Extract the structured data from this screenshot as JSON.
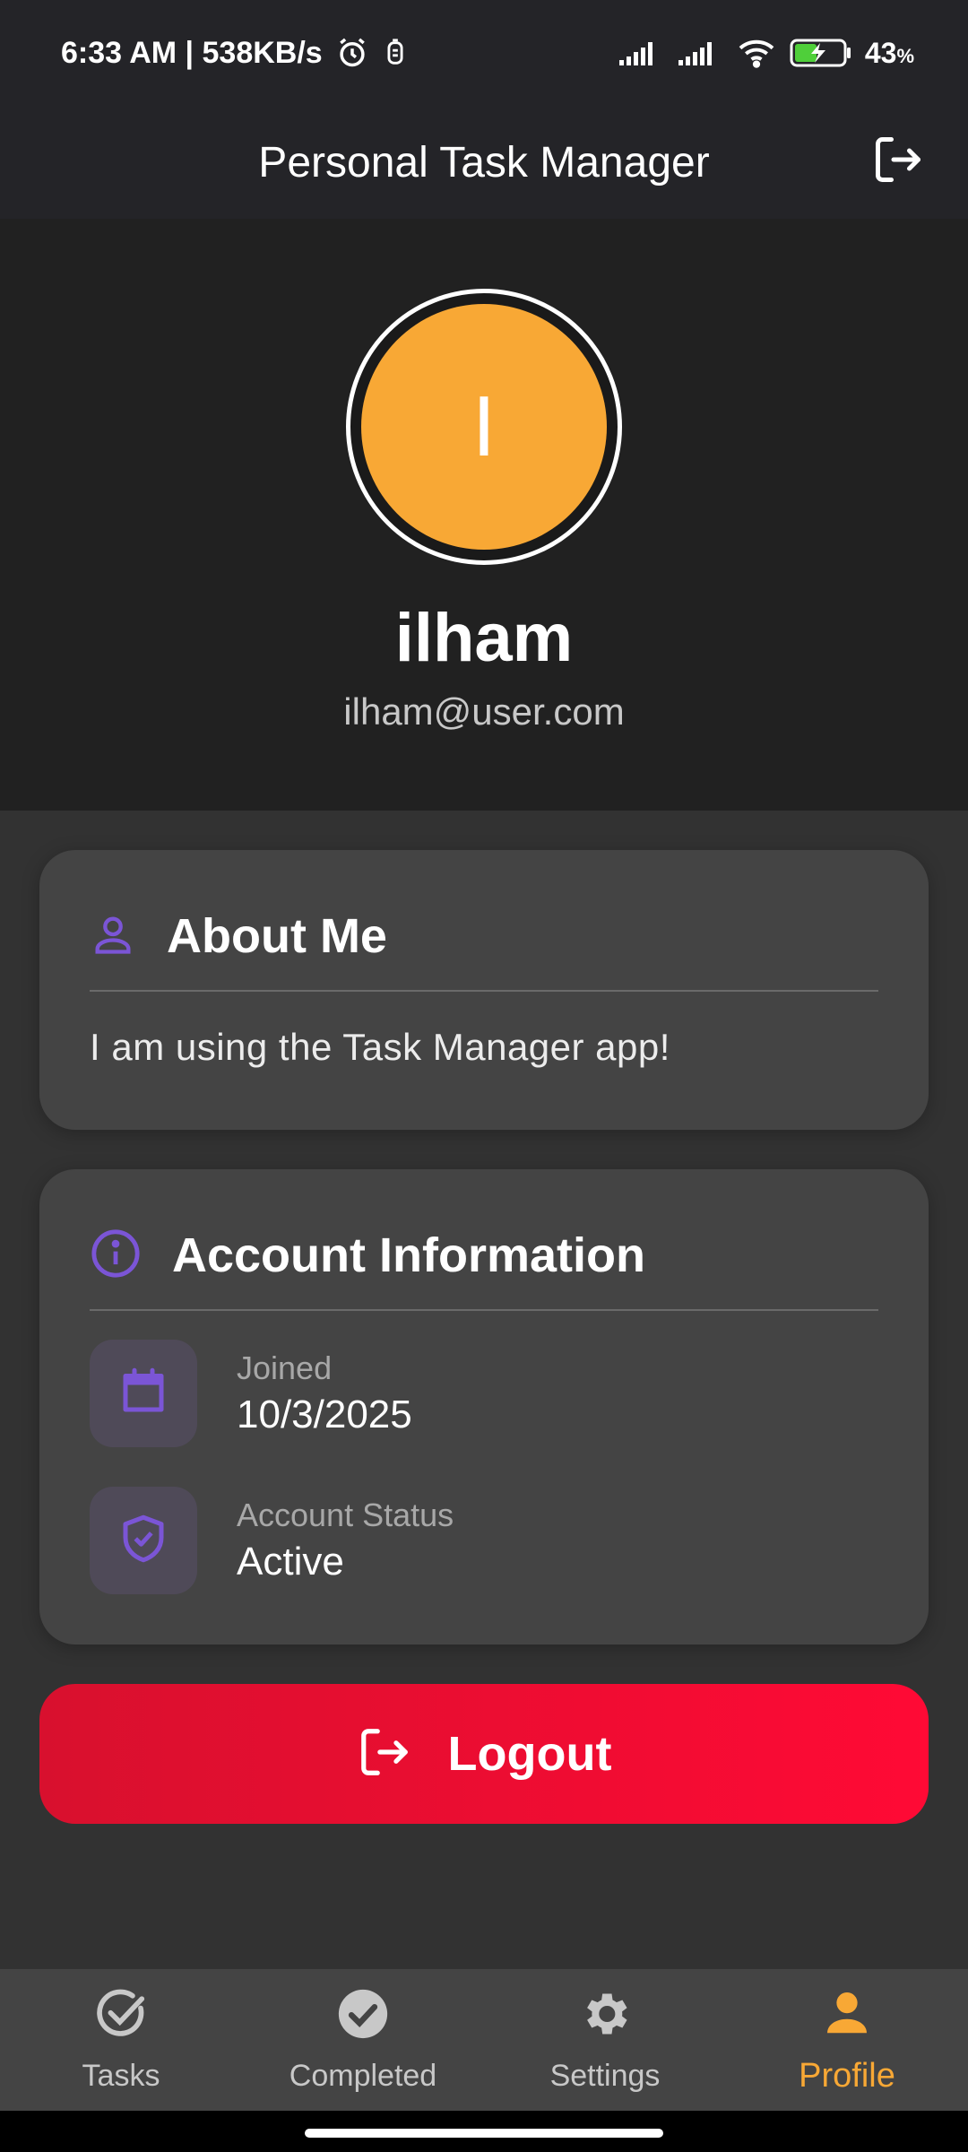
{
  "status_bar": {
    "time_speed": "6:33 AM | 538KB/s",
    "battery_percent": "43",
    "battery_unit": "%"
  },
  "app_bar": {
    "title": "Personal Task Manager"
  },
  "profile": {
    "avatar_initial": "I",
    "name": "ilham",
    "email": "ilham@user.com"
  },
  "about": {
    "title": "About Me",
    "text": "I am using the Task Manager app!"
  },
  "account": {
    "title": "Account Information",
    "joined_label": "Joined",
    "joined_value": "10/3/2025",
    "status_label": "Account Status",
    "status_value": "Active"
  },
  "logout": {
    "label": "Logout"
  },
  "bottom_nav": {
    "items": [
      {
        "label": "Tasks",
        "icon": "task-check-outline-icon"
      },
      {
        "label": "Completed",
        "icon": "check-circle-icon"
      },
      {
        "label": "Settings",
        "icon": "gear-icon"
      },
      {
        "label": "Profile",
        "icon": "person-icon"
      }
    ],
    "active": "Profile"
  },
  "colors": {
    "accent_orange": "#f8a835",
    "accent_purple": "#7b55d6",
    "logout_red": "#ff0a35",
    "background": "#323232",
    "card": "#444444"
  }
}
